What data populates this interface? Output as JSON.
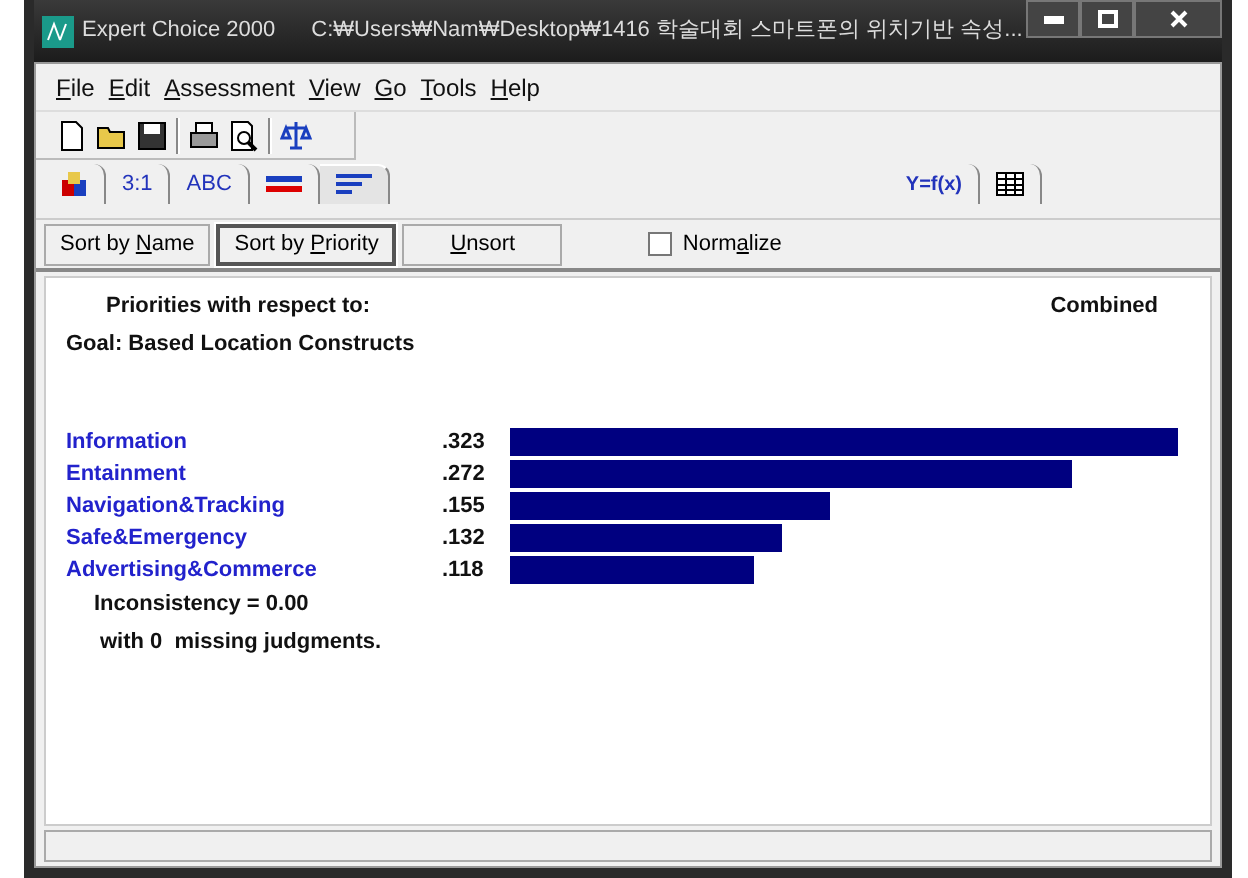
{
  "window": {
    "title": "Expert Choice 2000",
    "path": "C:₩Users₩Nam₩Desktop₩1416 학술대회 스마트폰의 위치기반 속성..."
  },
  "menu": [
    {
      "key": "F",
      "rest": "ile"
    },
    {
      "key": "E",
      "rest": "dit"
    },
    {
      "key": "A",
      "rest": "ssessment"
    },
    {
      "key": "V",
      "rest": "iew"
    },
    {
      "key": "G",
      "rest": "o"
    },
    {
      "key": "T",
      "rest": "ools"
    },
    {
      "key": "H",
      "rest": "elp"
    }
  ],
  "toolbar": [
    {
      "kind": "new"
    },
    {
      "kind": "open"
    },
    {
      "kind": "save"
    },
    {
      "kind": "sep"
    },
    {
      "kind": "print"
    },
    {
      "kind": "preview"
    },
    {
      "kind": "sep"
    },
    {
      "kind": "scale"
    }
  ],
  "tabs": [
    {
      "kind": "blocks",
      "selected": false
    },
    {
      "kind": "text",
      "label": "3:1",
      "selected": false
    },
    {
      "kind": "text",
      "label": "ABC",
      "selected": false
    },
    {
      "kind": "lines",
      "selected": false
    },
    {
      "kind": "sortbars",
      "selected": true
    },
    {
      "kind": "formula",
      "label": "Y=f(x)",
      "selected": false
    },
    {
      "kind": "grid",
      "selected": false
    }
  ],
  "sort_buttons": [
    {
      "before": "Sort by ",
      "key": "N",
      "after": "ame",
      "selected": false
    },
    {
      "before": "Sort by ",
      "key": "P",
      "after": "riority",
      "selected": true
    },
    {
      "key": "U",
      "after": "nsort",
      "selected": false
    }
  ],
  "normalize": {
    "before": "Norm",
    "key": "a",
    "after": "lize",
    "checked": false
  },
  "header": {
    "priorities": "Priorities with respect to:",
    "combined": "Combined",
    "goal": "Goal: Based Location Constructs"
  },
  "items": [
    {
      "name": "Information",
      "value": ".323"
    },
    {
      "name": "Entainment",
      "value": ".272"
    },
    {
      "name": "Navigation&Tracking",
      "value": ".155"
    },
    {
      "name": "Safe&Emergency",
      "value": ".132"
    },
    {
      "name": "Advertising&Commerce",
      "value": ".118"
    }
  ],
  "inconsistency": "Inconsistency = 0.00",
  "missing": "with 0  missing judgments."
}
